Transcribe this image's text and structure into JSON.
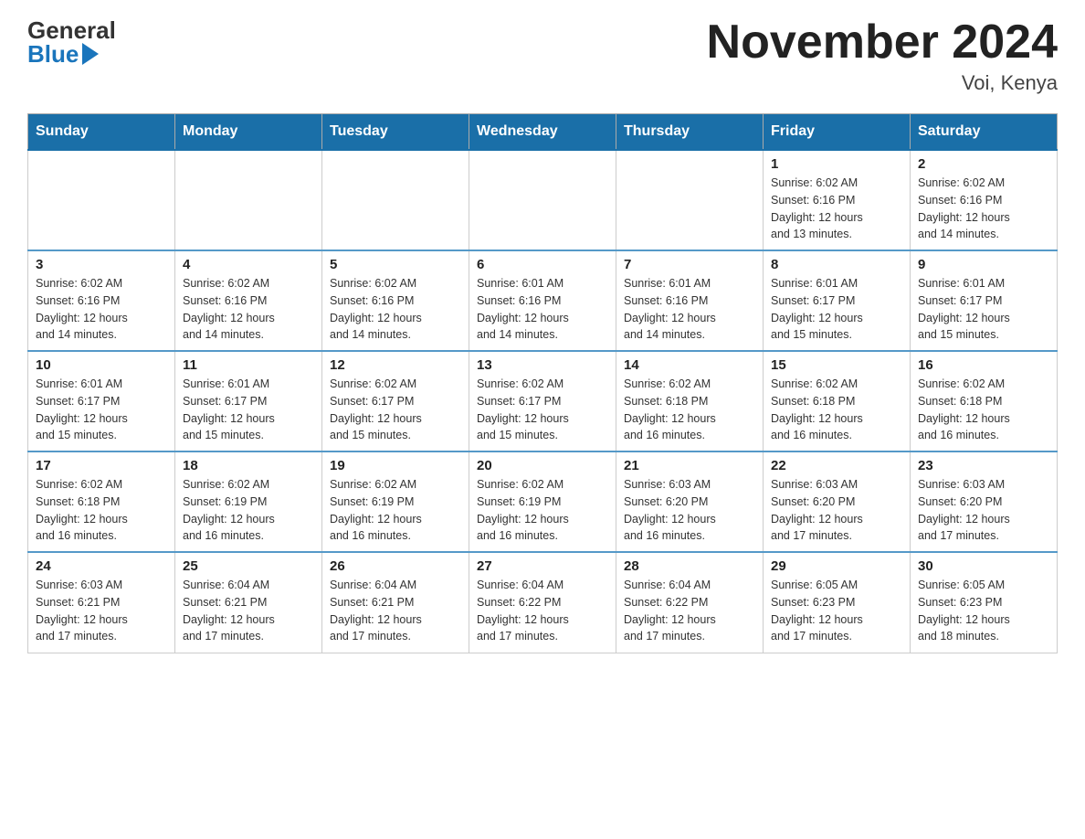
{
  "header": {
    "logo_general": "General",
    "logo_blue": "Blue",
    "title": "November 2024",
    "location": "Voi, Kenya"
  },
  "weekdays": [
    "Sunday",
    "Monday",
    "Tuesday",
    "Wednesday",
    "Thursday",
    "Friday",
    "Saturday"
  ],
  "weeks": [
    [
      {
        "day": "",
        "info": ""
      },
      {
        "day": "",
        "info": ""
      },
      {
        "day": "",
        "info": ""
      },
      {
        "day": "",
        "info": ""
      },
      {
        "day": "",
        "info": ""
      },
      {
        "day": "1",
        "info": "Sunrise: 6:02 AM\nSunset: 6:16 PM\nDaylight: 12 hours\nand 13 minutes."
      },
      {
        "day": "2",
        "info": "Sunrise: 6:02 AM\nSunset: 6:16 PM\nDaylight: 12 hours\nand 14 minutes."
      }
    ],
    [
      {
        "day": "3",
        "info": "Sunrise: 6:02 AM\nSunset: 6:16 PM\nDaylight: 12 hours\nand 14 minutes."
      },
      {
        "day": "4",
        "info": "Sunrise: 6:02 AM\nSunset: 6:16 PM\nDaylight: 12 hours\nand 14 minutes."
      },
      {
        "day": "5",
        "info": "Sunrise: 6:02 AM\nSunset: 6:16 PM\nDaylight: 12 hours\nand 14 minutes."
      },
      {
        "day": "6",
        "info": "Sunrise: 6:01 AM\nSunset: 6:16 PM\nDaylight: 12 hours\nand 14 minutes."
      },
      {
        "day": "7",
        "info": "Sunrise: 6:01 AM\nSunset: 6:16 PM\nDaylight: 12 hours\nand 14 minutes."
      },
      {
        "day": "8",
        "info": "Sunrise: 6:01 AM\nSunset: 6:17 PM\nDaylight: 12 hours\nand 15 minutes."
      },
      {
        "day": "9",
        "info": "Sunrise: 6:01 AM\nSunset: 6:17 PM\nDaylight: 12 hours\nand 15 minutes."
      }
    ],
    [
      {
        "day": "10",
        "info": "Sunrise: 6:01 AM\nSunset: 6:17 PM\nDaylight: 12 hours\nand 15 minutes."
      },
      {
        "day": "11",
        "info": "Sunrise: 6:01 AM\nSunset: 6:17 PM\nDaylight: 12 hours\nand 15 minutes."
      },
      {
        "day": "12",
        "info": "Sunrise: 6:02 AM\nSunset: 6:17 PM\nDaylight: 12 hours\nand 15 minutes."
      },
      {
        "day": "13",
        "info": "Sunrise: 6:02 AM\nSunset: 6:17 PM\nDaylight: 12 hours\nand 15 minutes."
      },
      {
        "day": "14",
        "info": "Sunrise: 6:02 AM\nSunset: 6:18 PM\nDaylight: 12 hours\nand 16 minutes."
      },
      {
        "day": "15",
        "info": "Sunrise: 6:02 AM\nSunset: 6:18 PM\nDaylight: 12 hours\nand 16 minutes."
      },
      {
        "day": "16",
        "info": "Sunrise: 6:02 AM\nSunset: 6:18 PM\nDaylight: 12 hours\nand 16 minutes."
      }
    ],
    [
      {
        "day": "17",
        "info": "Sunrise: 6:02 AM\nSunset: 6:18 PM\nDaylight: 12 hours\nand 16 minutes."
      },
      {
        "day": "18",
        "info": "Sunrise: 6:02 AM\nSunset: 6:19 PM\nDaylight: 12 hours\nand 16 minutes."
      },
      {
        "day": "19",
        "info": "Sunrise: 6:02 AM\nSunset: 6:19 PM\nDaylight: 12 hours\nand 16 minutes."
      },
      {
        "day": "20",
        "info": "Sunrise: 6:02 AM\nSunset: 6:19 PM\nDaylight: 12 hours\nand 16 minutes."
      },
      {
        "day": "21",
        "info": "Sunrise: 6:03 AM\nSunset: 6:20 PM\nDaylight: 12 hours\nand 16 minutes."
      },
      {
        "day": "22",
        "info": "Sunrise: 6:03 AM\nSunset: 6:20 PM\nDaylight: 12 hours\nand 17 minutes."
      },
      {
        "day": "23",
        "info": "Sunrise: 6:03 AM\nSunset: 6:20 PM\nDaylight: 12 hours\nand 17 minutes."
      }
    ],
    [
      {
        "day": "24",
        "info": "Sunrise: 6:03 AM\nSunset: 6:21 PM\nDaylight: 12 hours\nand 17 minutes."
      },
      {
        "day": "25",
        "info": "Sunrise: 6:04 AM\nSunset: 6:21 PM\nDaylight: 12 hours\nand 17 minutes."
      },
      {
        "day": "26",
        "info": "Sunrise: 6:04 AM\nSunset: 6:21 PM\nDaylight: 12 hours\nand 17 minutes."
      },
      {
        "day": "27",
        "info": "Sunrise: 6:04 AM\nSunset: 6:22 PM\nDaylight: 12 hours\nand 17 minutes."
      },
      {
        "day": "28",
        "info": "Sunrise: 6:04 AM\nSunset: 6:22 PM\nDaylight: 12 hours\nand 17 minutes."
      },
      {
        "day": "29",
        "info": "Sunrise: 6:05 AM\nSunset: 6:23 PM\nDaylight: 12 hours\nand 17 minutes."
      },
      {
        "day": "30",
        "info": "Sunrise: 6:05 AM\nSunset: 6:23 PM\nDaylight: 12 hours\nand 18 minutes."
      }
    ]
  ]
}
